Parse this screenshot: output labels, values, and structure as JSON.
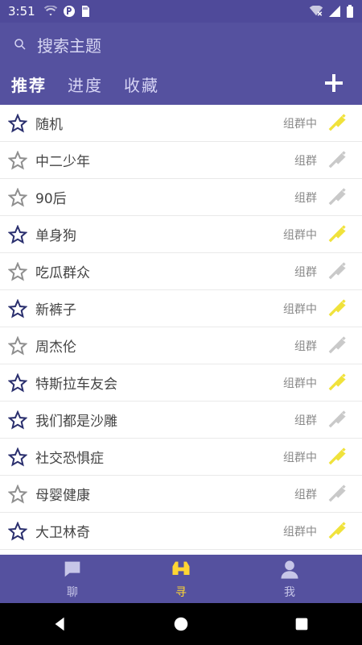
{
  "status_bar": {
    "time": "3:51"
  },
  "search": {
    "placeholder": "搜索主题"
  },
  "tabs": [
    {
      "label": "推荐",
      "active": true
    },
    {
      "label": "进度",
      "active": false
    },
    {
      "label": "收藏",
      "active": false
    }
  ],
  "rows": [
    {
      "name": "随机",
      "status": "组群中",
      "starred": true,
      "horn_active": true
    },
    {
      "name": "中二少年",
      "status": "组群",
      "starred": false,
      "horn_active": false
    },
    {
      "name": "90后",
      "status": "组群",
      "starred": false,
      "horn_active": false
    },
    {
      "name": "单身狗",
      "status": "组群中",
      "starred": true,
      "horn_active": true
    },
    {
      "name": "吃瓜群众",
      "status": "组群",
      "starred": false,
      "horn_active": false
    },
    {
      "name": "新裤子",
      "status": "组群中",
      "starred": true,
      "horn_active": true
    },
    {
      "name": "周杰伦",
      "status": "组群",
      "starred": false,
      "horn_active": false
    },
    {
      "name": "特斯拉车友会",
      "status": "组群中",
      "starred": true,
      "horn_active": true
    },
    {
      "name": "我们都是沙雕",
      "status": "组群",
      "starred": true,
      "horn_active": false
    },
    {
      "name": "社交恐惧症",
      "status": "组群中",
      "starred": true,
      "horn_active": true
    },
    {
      "name": "母婴健康",
      "status": "组群",
      "starred": false,
      "horn_active": false
    },
    {
      "name": "大卫林奇",
      "status": "组群中",
      "starred": true,
      "horn_active": true
    }
  ],
  "bottom_nav": [
    {
      "label": "聊",
      "icon": "chat-icon",
      "active": false
    },
    {
      "label": "寻",
      "icon": "binoculars-icon",
      "active": true
    },
    {
      "label": "我",
      "icon": "user-icon",
      "active": false
    }
  ],
  "colors": {
    "header": "#55519f",
    "active_tab_text": "#ffffff",
    "inactive_tab_text": "#d6d4f4",
    "star_active": "#2a2f6e",
    "star_inactive": "#8f8f8f",
    "horn_active": "#f0e23b",
    "horn_inactive": "#c9c9c9",
    "bottom_active": "#ffd633"
  }
}
